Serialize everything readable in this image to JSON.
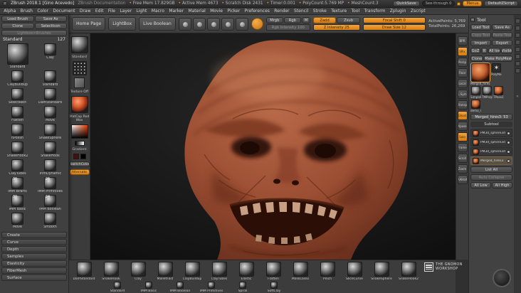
{
  "colors": {
    "accent": "#e9962e",
    "sculpt_base": "#9c4f33",
    "canvas_bg": "#141414"
  },
  "titlebar": {
    "title": "ZBrush 2018.1 [Gino Acevedo]",
    "doc_link": "ZBrush Documentation",
    "stats": [
      "Free Mem 17.829GB",
      "Active Mem 4673",
      "Scratch Disk 2431",
      "Timer:0.001",
      "PolyCount:5.769 MP",
      "MeshCount:3"
    ],
    "quicksave": "QuickSave",
    "see_through": "See-through 0",
    "menus": "Menus",
    "zscript": "DefaultZScript"
  },
  "menubar": {
    "items": [
      "Alpha",
      "Brush",
      "Color",
      "Document",
      "Draw",
      "Edit",
      "File",
      "Layer",
      "Light",
      "Macro",
      "Marker",
      "Material",
      "Movie",
      "Picker",
      "Preferences",
      "Render",
      "Stencil",
      "Stroke",
      "Texture",
      "Tool",
      "Transform",
      "Zplugin",
      "Zscript"
    ]
  },
  "toolbar": {
    "home": "Home Page",
    "lightbox": "LightBox",
    "live_boolean": "Live Boolean",
    "mode_icons": [
      "edit",
      "draw",
      "move",
      "scale",
      "rotate"
    ],
    "mrgb": "Mrgb",
    "rgb": "Rgb",
    "m": "M",
    "rgb_intensity": "Rgb Intensity 100",
    "zadd": "Zadd",
    "zsub": "Zsub",
    "z_intensity": "Z Intensity 25",
    "focal_shift": "Focal Shift 0",
    "draw_size": "Draw Size 12",
    "active_points": "ActivePoints: 5,769",
    "total_points": "TotalPoints: 26,269"
  },
  "brush_panel": {
    "load": "Load Brush",
    "save_as": "Save As",
    "clone": "Clone",
    "select_icon": "SelectIcon",
    "lightbox_toggle": "Lightbox>Brushes",
    "current_name": "Standard",
    "current_count": "127",
    "brushes": [
      {
        "label": "Standard",
        "big": true
      },
      {
        "label": "Clay"
      },
      {
        "label": "ClayBuildup"
      },
      {
        "label": "Standard"
      },
      {
        "label": "SelectRect"
      },
      {
        "label": "DamStandard"
      },
      {
        "label": "Flatten"
      },
      {
        "label": "Move"
      },
      {
        "label": "hPolish"
      },
      {
        "label": "SnakeSphere"
      },
      {
        "label": "SnakeHook2"
      },
      {
        "label": "SnakeHook"
      },
      {
        "label": "ClayTubes"
      },
      {
        "label": "TrimDynamic"
      },
      {
        "label": "IMM BParts",
        "count": "30"
      },
      {
        "label": "IMM Primitives",
        "count": "26"
      },
      {
        "label": "IMM Basic",
        "count": "30"
      },
      {
        "label": "IMM Boolean",
        "count": "24"
      },
      {
        "label": "Move"
      },
      {
        "label": "Smooth"
      }
    ],
    "sections": [
      "Create",
      "Curve",
      "Depth",
      "Samples",
      "Elasticity",
      "FiberMesh",
      "Surface"
    ]
  },
  "left_shelf": {
    "brush_label": "Standard",
    "texture_label": "Texture Off",
    "material_label": "MatCap Red Wax",
    "gradient_label": "Gradient",
    "switch_label": "SwitchColor",
    "alternate_label": "Alternate"
  },
  "right_shelf": {
    "icons": [
      {
        "label": "BPR"
      },
      {
        "label": "SPix",
        "slider": true
      },
      {
        "label": "Persp"
      },
      {
        "label": "Floor"
      },
      {
        "label": "Local"
      },
      {
        "label": "L.Sym"
      },
      {
        "label": "Transp"
      },
      {
        "label": "Ghost",
        "active": true
      },
      {
        "label": "Xpose"
      },
      {
        "label": "Solo",
        "active": true
      },
      {
        "label": "Frame"
      },
      {
        "label": "Scroll"
      },
      {
        "label": "Zoom"
      },
      {
        "label": "AAHalf"
      }
    ]
  },
  "tool_panel": {
    "header": "Tool",
    "load": "Load Tool",
    "save_as": "Save As",
    "copy": "Copy Tool",
    "paste": "Paste Tool",
    "import": "Import",
    "export": "Export",
    "goz": "GoZ",
    "goz_r": "R",
    "all_low": "All low",
    "visible": "Visible",
    "clone": "Clone",
    "make_polymesh": "Make PolyMesh3D",
    "tools": [
      {
        "name": "Merged_hires3",
        "type": "head",
        "active": true
      },
      {
        "name": "PolyMesh3D",
        "type": "star"
      },
      {
        "name": "SimpleBrush",
        "type": "gray"
      },
      {
        "name": "TMPolyMesh_1",
        "type": "gray"
      },
      {
        "name": "TPose2_skin_lo",
        "type": "head"
      },
      {
        "name": "demo_mesh_ver",
        "type": "head"
      }
    ],
    "active_tool_label": "Merged_hires3: 53",
    "subtool": {
      "header": "Subtool",
      "items": [
        {
          "name": "PM3d_sphere3d1_8"
        },
        {
          "name": "PM3d_sphere3d1_6"
        },
        {
          "name": "PM3d_sphere3d1_6"
        },
        {
          "name": "Merged_hires3",
          "selected": true
        }
      ],
      "list_all": "List All",
      "auto_collapse": "Auto Collapse",
      "btn_all_low": "All Low",
      "btn_all_high": "All High"
    }
  },
  "bottom_tray": {
    "row1": [
      {
        "label": "DamStandard"
      },
      {
        "label": "SnakeHook"
      },
      {
        "label": "Clay"
      },
      {
        "label": "MalletFast"
      },
      {
        "label": "ClayBuildup"
      },
      {
        "label": "ClayTubes"
      },
      {
        "label": "Elastic"
      },
      {
        "label": "Flatten"
      },
      {
        "label": "MaskLasso"
      },
      {
        "label": "Pinch"
      },
      {
        "label": "SliceCurve"
      },
      {
        "label": "SnakeSphere"
      },
      {
        "label": "SnakeHook2"
      }
    ],
    "row2": [
      {
        "label": "Standard"
      },
      {
        "label": "IMM Basic"
      },
      {
        "label": "IMM Boolean"
      },
      {
        "label": "IMM Primitives"
      },
      {
        "label": "Spiral"
      },
      {
        "label": "SoftClay"
      }
    ]
  },
  "watermark": {
    "line1": "THE GNOMON",
    "line2": "WORKSHOP"
  }
}
